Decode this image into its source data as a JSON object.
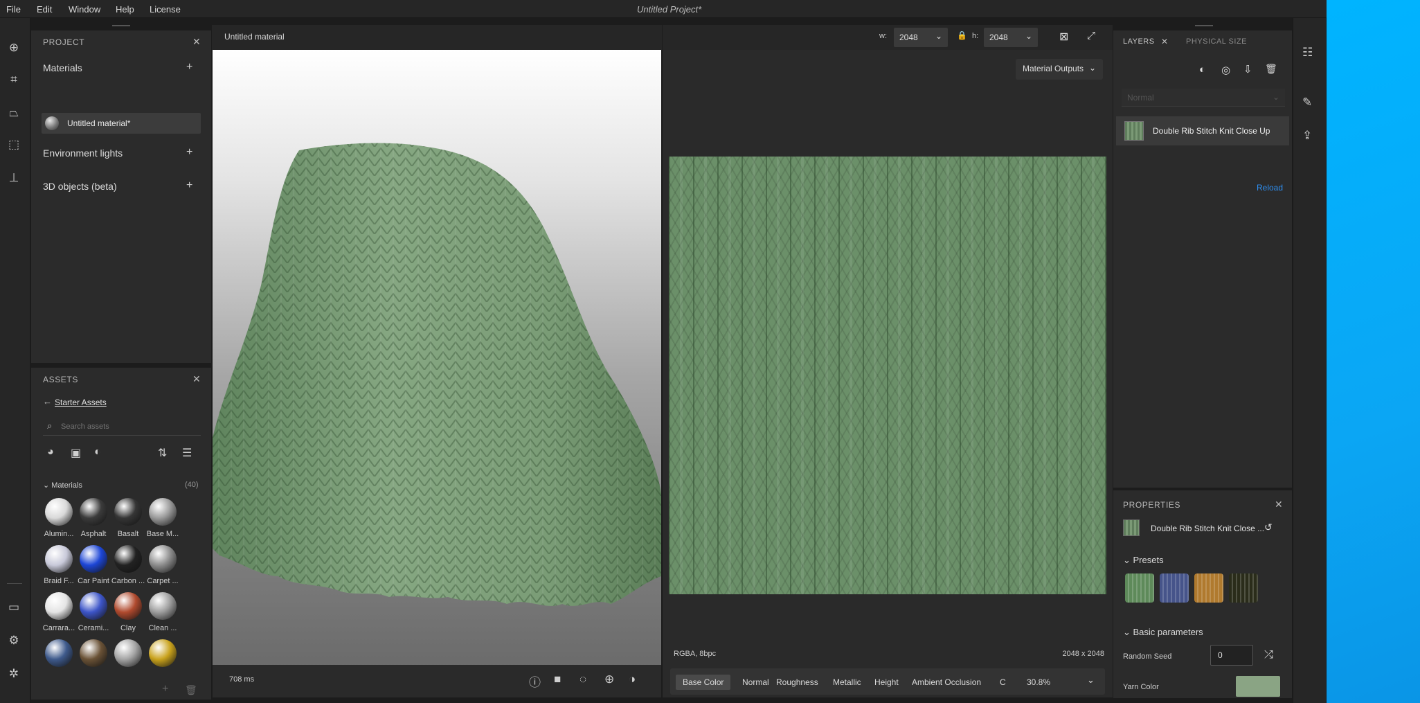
{
  "menubar": {
    "items": [
      "File",
      "Edit",
      "Window",
      "Help",
      "License"
    ],
    "title": "Untitled Project*"
  },
  "project": {
    "header": "PROJECT",
    "sections": {
      "materials": "Materials",
      "env": "Environment lights",
      "objects": "3D objects (beta)"
    },
    "selected_material": "Untitled material*"
  },
  "assets": {
    "header": "ASSETS",
    "breadcrumb": "Starter Assets",
    "search_placeholder": "Search assets",
    "materials_header": "Materials",
    "materials_count": "(40)",
    "swatches": [
      {
        "label": "Alumin...",
        "color": "#d9d9d9"
      },
      {
        "label": "Asphalt",
        "color": "#3b3b3b"
      },
      {
        "label": "Basalt",
        "color": "#353535"
      },
      {
        "label": "Base M...",
        "color": "#9a9a9a"
      },
      {
        "label": "Braid F...",
        "color": "#c8c9d9"
      },
      {
        "label": "Car Paint",
        "color": "#1d46d6"
      },
      {
        "label": "Carbon ...",
        "color": "#222222"
      },
      {
        "label": "Carpet ...",
        "color": "#8d8d8d"
      },
      {
        "label": "Carrara...",
        "color": "#e4e4e4"
      },
      {
        "label": "Cerami...",
        "color": "#3d55c8"
      },
      {
        "label": "Clay",
        "color": "#b04a2e"
      },
      {
        "label": "Clean ...",
        "color": "#9d9d9d"
      },
      {
        "label": "",
        "color": "#3e5a8c"
      },
      {
        "label": "",
        "color": "#6a5236"
      },
      {
        "label": "",
        "color": "#a4a4a4"
      },
      {
        "label": "",
        "color": "#c9a21c"
      }
    ]
  },
  "viewport": {
    "title": "Untitled material",
    "width_label": "w:",
    "width_value": "2048",
    "height_label": "h:",
    "height_value": "2048",
    "render_time": "708 ms"
  },
  "texture_view": {
    "outputs_label": "Material Outputs",
    "format": "RGBA, 8bpc",
    "resolution": "2048 x 2048",
    "channels": [
      "Base Color",
      "Normal",
      "Roughness",
      "Metallic",
      "Height",
      "Ambient Occlusion",
      "C"
    ],
    "active_channel": "Base Color",
    "zoom": "30.8%"
  },
  "layers": {
    "tab_layers": "LAYERS",
    "tab_physical": "PHYSICAL SIZE",
    "blend_mode": "Normal",
    "layer_name": "Double Rib Stitch Knit Close Up",
    "reload_label": "Reload"
  },
  "properties": {
    "header": "PROPERTIES",
    "name": "Double Rib Stitch Knit Close ...",
    "presets_label": "Presets",
    "basic_label": "Basic parameters",
    "random_seed_label": "Random Seed",
    "random_seed_value": "0",
    "yarn_color_label": "Yarn Color",
    "yarn_color": "#8aa484",
    "preset_colors": [
      "#5e8a5a",
      "#46548a",
      "#b07a2e",
      "#2a2c1a"
    ]
  },
  "colors": {
    "accent_link": "#2e8ff2",
    "knit_green": "#6b9069"
  }
}
